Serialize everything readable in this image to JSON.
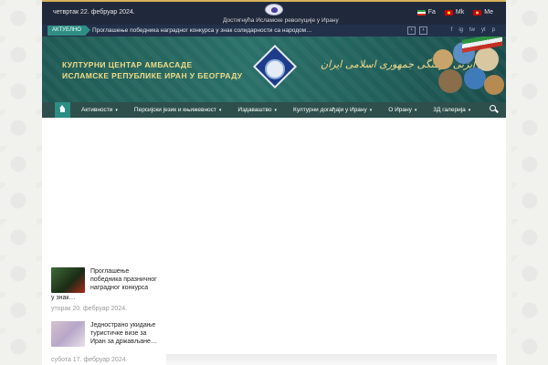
{
  "topbar": {
    "date": "четвртак 22. фебруар 2024.",
    "tagline": "Достигнућа Исламске револуције у Ирану",
    "languages": [
      {
        "label": "Fa",
        "flag": "iran-flag"
      },
      {
        "label": "Mk",
        "flag": "macedonia-flag"
      },
      {
        "label": "Me",
        "flag": "montenegro-flag"
      }
    ]
  },
  "ticker": {
    "badge": "АКТУЕЛНО",
    "headline": "Проглашење победника наградног конкурса у знак солидарности са народом…",
    "prev": "‹",
    "next": "›",
    "socials": [
      "f",
      "ig",
      "tw",
      "yt",
      "p"
    ]
  },
  "banner": {
    "title_line1": "КУЛТУРНИ ЦЕНТАР АМБАСАДЕ",
    "title_line2": "ИСЛАМСКЕ РЕПУБЛИКЕ ИРАН У БЕОГРАДУ",
    "persian": "رایزنی فرهنگی جمهوری اسلامی ایران"
  },
  "nav": {
    "items": [
      {
        "label": "Активности",
        "has_dropdown": true
      },
      {
        "label": "Персијски језик и књижевност",
        "has_dropdown": true
      },
      {
        "label": "Издаваштво",
        "has_dropdown": true
      },
      {
        "label": "Културни догађаји у Ирану",
        "has_dropdown": true
      },
      {
        "label": "О Ирану",
        "has_dropdown": true
      },
      {
        "label": "3Д галерија",
        "has_dropdown": true
      }
    ]
  },
  "posts": [
    {
      "title": "Проглашење победника празничног наградног конкурса",
      "tail": "у знак…",
      "date": "уторак 20. фебруар 2024."
    },
    {
      "title": "Једнострано укидање туристичке визе за Иран за држављане…",
      "date": "субота 17. фебруар 2024."
    }
  ],
  "colors": {
    "topbar": "#20283c",
    "accent": "#2d8f84",
    "nav": "#2e4f4c",
    "banner": "#2a7068",
    "title_gold": "#f1dc86"
  }
}
